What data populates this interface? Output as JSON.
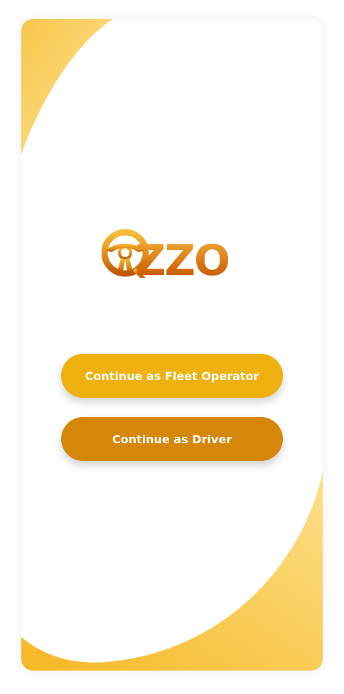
{
  "app": {
    "logo_text": "ZZO",
    "logo_icon": "steering-wheel-icon"
  },
  "actions": {
    "fleet_label": "Continue as Fleet Operator",
    "driver_label": "Continue as Driver"
  },
  "colors": {
    "fleet_button": "#efb10f",
    "driver_button": "#d5870a",
    "accent_yellow": "#f7c33a",
    "accent_light": "#fde08a",
    "logo_dark": "#d66a0c"
  }
}
